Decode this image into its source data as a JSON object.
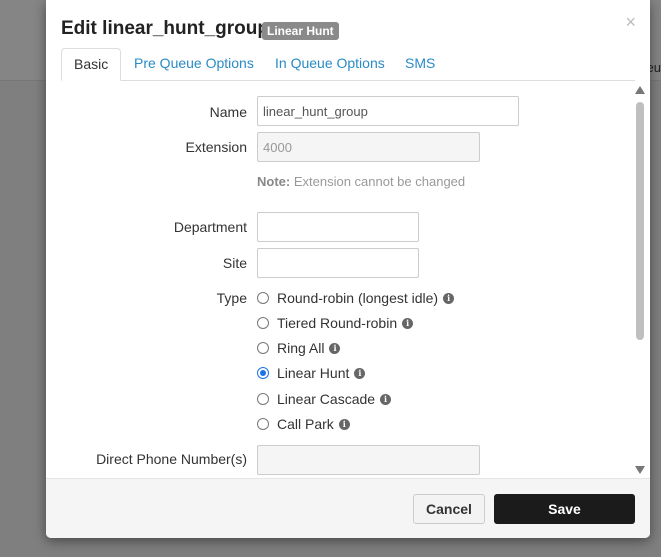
{
  "background": {
    "peek_text": "eu"
  },
  "modal": {
    "title": "Edit linear_hunt_group",
    "badge": "Linear Hunt",
    "close_glyph": "×"
  },
  "tabs": [
    {
      "label": "Basic",
      "active": true
    },
    {
      "label": "Pre Queue Options",
      "active": false
    },
    {
      "label": "In Queue Options",
      "active": false
    },
    {
      "label": "SMS",
      "active": false
    }
  ],
  "form": {
    "name": {
      "label": "Name",
      "value": "linear_hunt_group"
    },
    "extension": {
      "label": "Extension",
      "value": "4000"
    },
    "note": {
      "prefix": "Note:",
      "text": " Extension cannot be changed"
    },
    "department": {
      "label": "Department",
      "value": ""
    },
    "site": {
      "label": "Site",
      "value": ""
    },
    "type": {
      "label": "Type",
      "selected": "Linear Hunt",
      "options": [
        {
          "label": "Round-robin (longest idle)",
          "checked": false
        },
        {
          "label": "Tiered Round-robin",
          "checked": false
        },
        {
          "label": "Ring All",
          "checked": false
        },
        {
          "label": "Linear Hunt",
          "checked": true
        },
        {
          "label": "Linear Cascade",
          "checked": false
        },
        {
          "label": "Call Park",
          "checked": false
        }
      ]
    },
    "direct_phone": {
      "label": "Direct Phone Number(s)",
      "value": ""
    }
  },
  "info_glyph": "i",
  "footer": {
    "cancel_label": "Cancel",
    "save_label": "Save"
  },
  "colors": {
    "accent": "#2a8bc6",
    "radio_checked": "#1a73e8",
    "save_button": "#1b1b1b"
  }
}
